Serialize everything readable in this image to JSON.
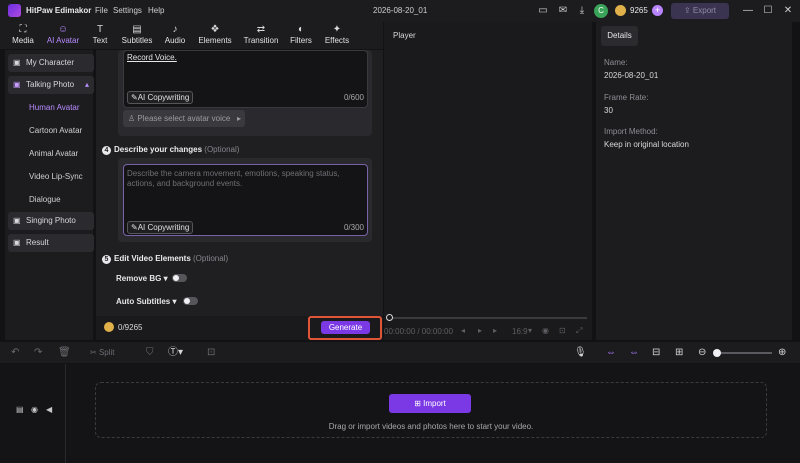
{
  "app": {
    "name": "HitPaw Edimakor",
    "menu": [
      "File",
      "Settings",
      "Help"
    ],
    "project_title": "2026-08-20_01",
    "credits": "9265",
    "avatar_letter": "C",
    "export_label": "Export"
  },
  "toolbar": {
    "tabs": [
      {
        "label": "Media",
        "icon": "media-icon"
      },
      {
        "label": "AI Avatar",
        "icon": "ai-avatar-icon",
        "active": true
      },
      {
        "label": "Text",
        "icon": "text-icon"
      },
      {
        "label": "Subtitles",
        "icon": "subtitles-icon"
      },
      {
        "label": "Audio",
        "icon": "audio-icon"
      },
      {
        "label": "Elements",
        "icon": "elements-icon"
      },
      {
        "label": "Transition",
        "icon": "transition-icon"
      },
      {
        "label": "Filters",
        "icon": "filters-icon"
      },
      {
        "label": "Effects",
        "icon": "effects-icon"
      }
    ]
  },
  "sidebar": {
    "my_character": "My Character",
    "talking_photo": "Talking Photo",
    "sub_items": [
      "Human Avatar",
      "Cartoon Avatar",
      "Animal Avatar",
      "Video Lip-Sync",
      "Dialogue"
    ],
    "singing_photo": "Singing Photo",
    "result": "Result"
  },
  "panel": {
    "record_voice": "Record Voice.",
    "ai_copywriting": "AI Copywriting",
    "voice_counter": "0/600",
    "select_voice": "Please select avatar voice",
    "step4_num": "4",
    "step4_title": "Describe your changes",
    "optional": "(Optional)",
    "describe_placeholder": "Describe the camera movement, emotions, speaking status, actions, and background events.",
    "describe_counter": "0/300",
    "step5_num": "5",
    "step5_title": "Edit Video Elements",
    "remove_bg": "Remove BG",
    "auto_subtitles": "Auto Subtitles",
    "cost": "0/9265",
    "generate": "Generate"
  },
  "player": {
    "title": "Player",
    "time": "00:00:00 / 00:00:00",
    "ratio": "16:9"
  },
  "details": {
    "tab": "Details",
    "name_label": "Name:",
    "name_value": "2026-08-20_01",
    "frame_rate_label": "Frame Rate:",
    "frame_rate_value": "30",
    "import_method_label": "Import Method:",
    "import_method_value": "Keep in original location"
  },
  "timeline": {
    "split": "Split",
    "import_label": "Import",
    "drop_hint": "Drag or import videos and photos here to start your video."
  },
  "colors": {
    "accent": "#7b39e6",
    "highlight_border": "#e0553a",
    "active_tab": "#b88cff"
  }
}
